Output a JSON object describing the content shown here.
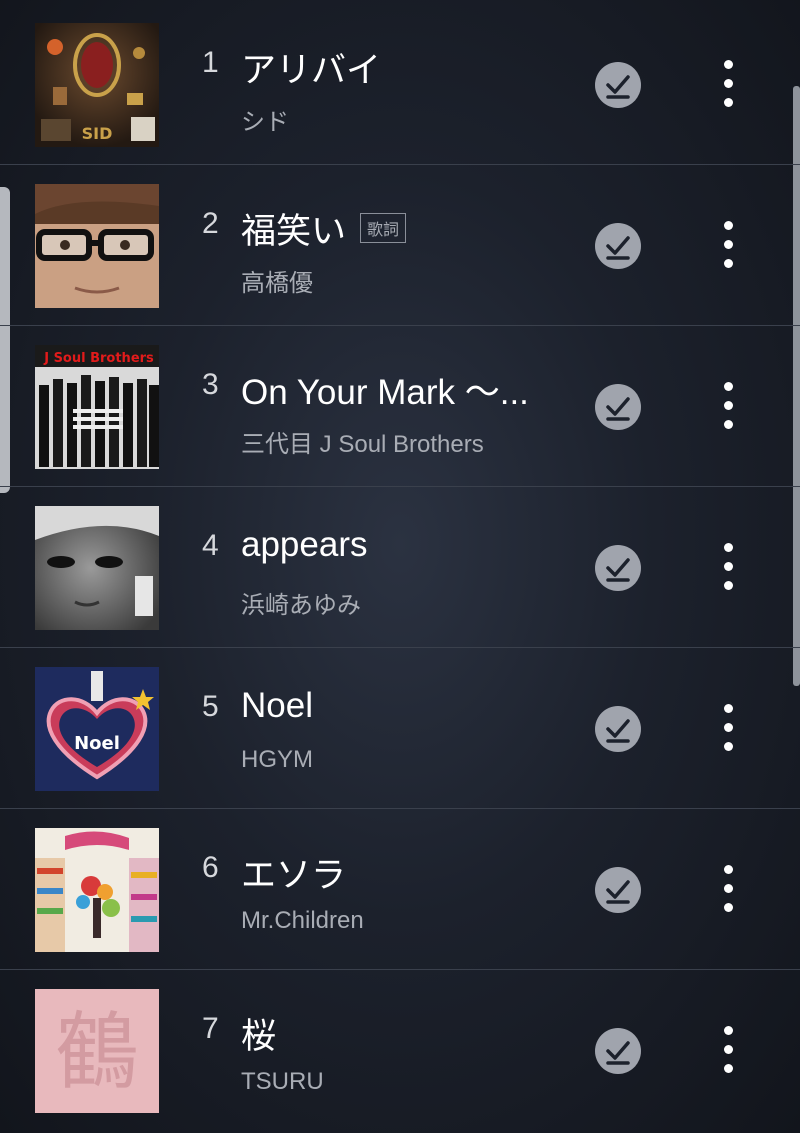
{
  "tracks": [
    {
      "number": "1",
      "title": "アリバイ",
      "artist": "シド",
      "has_lyrics": false,
      "lyrics_label": "",
      "art_icon": "album-art-hoshi-no-miyako",
      "art_text": "SID"
    },
    {
      "number": "2",
      "title": "福笑い",
      "artist": "高橋優",
      "has_lyrics": true,
      "lyrics_label": "歌詞",
      "art_icon": "album-art-fukuwarai"
    },
    {
      "number": "3",
      "title": "On Your Mark 〜...",
      "artist": "三代目 J Soul Brothers",
      "has_lyrics": false,
      "lyrics_label": "",
      "art_icon": "album-art-j-soul-brothers",
      "art_text": "J Soul Brothers"
    },
    {
      "number": "4",
      "title": "appears",
      "artist": "浜崎あゆみ",
      "has_lyrics": false,
      "lyrics_label": "",
      "art_icon": "album-art-appears"
    },
    {
      "number": "5",
      "title": "Noel",
      "artist": "HGYM",
      "has_lyrics": false,
      "lyrics_label": "",
      "art_icon": "album-art-noel",
      "art_text": "Noel"
    },
    {
      "number": "6",
      "title": "エソラ",
      "artist": "Mr.Children",
      "has_lyrics": false,
      "lyrics_label": "",
      "art_icon": "album-art-supermarket-fantasy"
    },
    {
      "number": "7",
      "title": "桜",
      "artist": "TSURU",
      "has_lyrics": false,
      "lyrics_label": "",
      "art_icon": "album-art-tsuru",
      "art_text": "鶴"
    }
  ],
  "icons": {
    "downloaded": "downloaded-check-icon",
    "more": "more-vertical-icon"
  },
  "colors": {
    "accent": "#a0a4ad",
    "background": "#1c212c",
    "title_text": "#ffffff",
    "artist_text": "#a9adb5"
  }
}
